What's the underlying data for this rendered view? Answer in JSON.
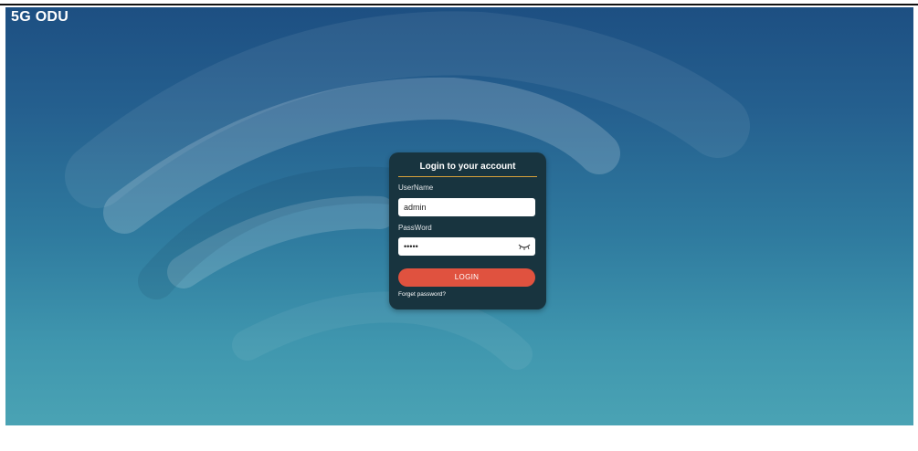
{
  "app": {
    "title": "5G ODU"
  },
  "login": {
    "title": "Login to your account",
    "username_label": "UserName",
    "username_value": "admin",
    "password_label": "PassWord",
    "password_value": "•••••",
    "login_button": "LOGIN",
    "forgot_link": "Forget password?"
  },
  "colors": {
    "background_top": "#1d4f82",
    "background_bottom": "#4aa3b4",
    "card_bg": "#18343f",
    "accent_rule": "#d8a23a",
    "login_button": "#e0523f"
  },
  "icons": {
    "password_toggle": "eye-closed-icon",
    "background": "wifi-signal-icon"
  }
}
